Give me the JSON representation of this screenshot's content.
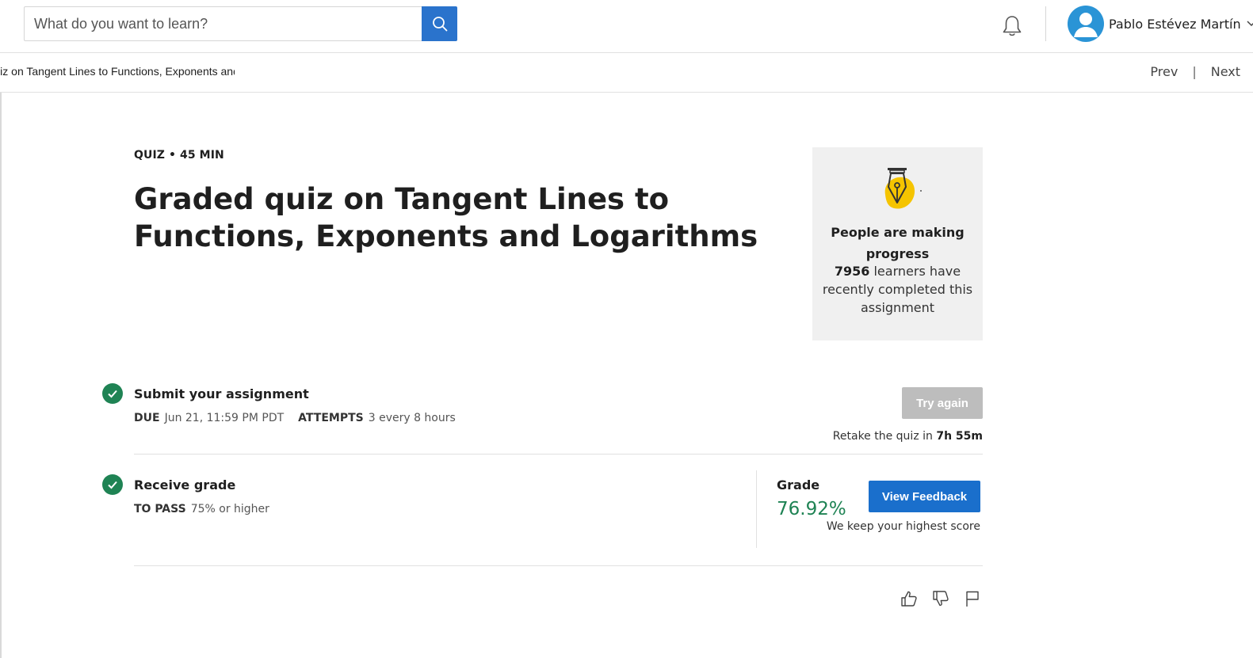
{
  "search": {
    "placeholder": "What do you want to learn?"
  },
  "user": {
    "name": "Pablo Estévez Martín"
  },
  "breadcrumb": {
    "text": "Graded quiz on Tangent Lines to Functions, Exponents and Logarithms"
  },
  "nav": {
    "prev": "Prev",
    "separator": "|",
    "next": "Next"
  },
  "quiz": {
    "meta": "QUIZ • 45 MIN",
    "title": "Graded quiz on Tangent Lines to Functions, Exponents and Logarithms"
  },
  "progress_card": {
    "heading": "People are making progress",
    "count": "7956",
    "text": "learners have recently completed this assignment"
  },
  "submit": {
    "title": "Submit your assignment",
    "due_label": "DUE",
    "due_value": "Jun 21, 11:59 PM PDT",
    "attempts_label": "ATTEMPTS",
    "attempts_value": "3 every 8 hours",
    "button": "Try again",
    "retake_prefix": "Retake the quiz in",
    "retake_time": "7h 55m"
  },
  "receive": {
    "title": "Receive grade",
    "pass_label": "TO PASS",
    "pass_value": "75% or higher",
    "grade_label": "Grade",
    "grade_value": "76.92%",
    "button": "View Feedback",
    "note": "We keep your highest score"
  },
  "colors": {
    "primary": "#1a6fcc",
    "success": "#1f8354",
    "disabled": "#bdbdbd",
    "avatar": "#2a94d6",
    "accent_icon": "#f5c400"
  },
  "icons": [
    "search-icon",
    "bell-icon",
    "avatar-icon",
    "chevron-down-icon",
    "pen-nib-icon",
    "check-icon",
    "thumbs-up-icon",
    "thumbs-down-icon",
    "flag-icon"
  ]
}
